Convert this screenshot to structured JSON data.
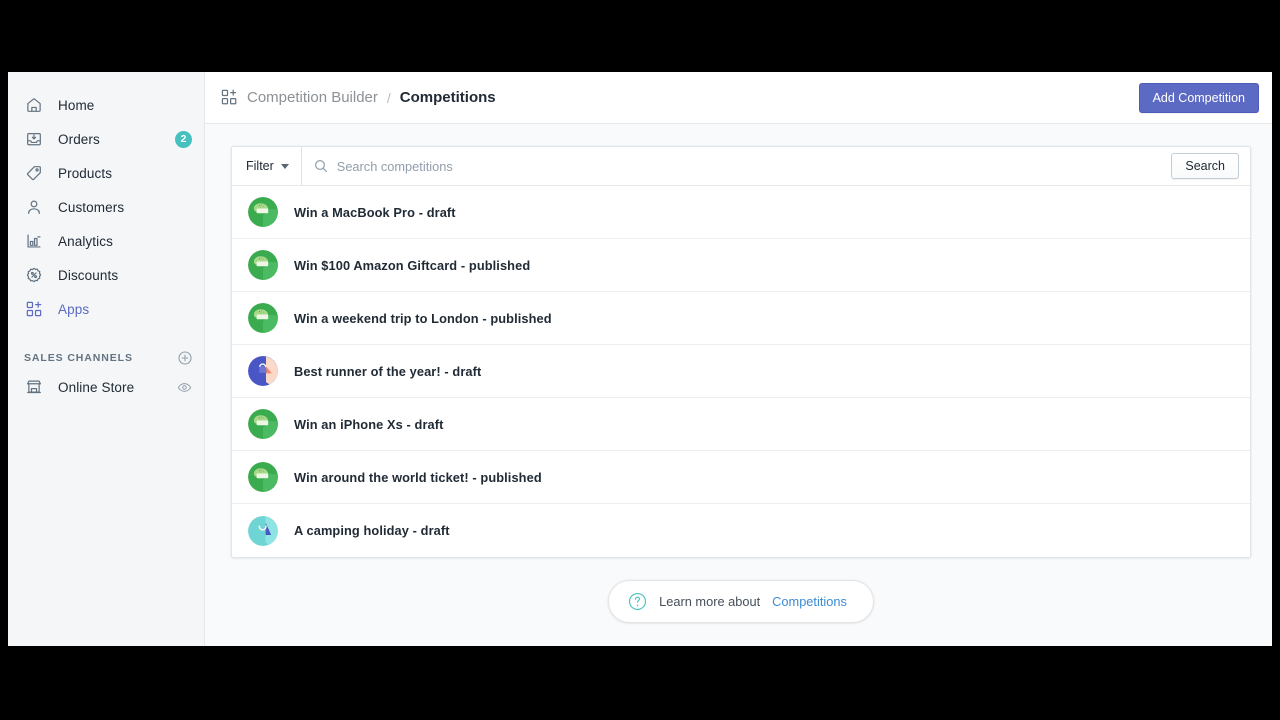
{
  "colors": {
    "accent_indigo": "#5c6ac4",
    "badge_teal": "#47c1bf",
    "link_blue": "#3b8bd6",
    "sidebar_bg": "#f4f6f8",
    "page_bg": "#f9fafb"
  },
  "sidebar": {
    "items": [
      {
        "label": "Home",
        "icon": "home-icon",
        "badge": "",
        "active": false
      },
      {
        "label": "Orders",
        "icon": "orders-icon",
        "badge": "2",
        "active": false
      },
      {
        "label": "Products",
        "icon": "products-icon",
        "badge": "",
        "active": false
      },
      {
        "label": "Customers",
        "icon": "customers-icon",
        "badge": "",
        "active": false
      },
      {
        "label": "Analytics",
        "icon": "analytics-icon",
        "badge": "",
        "active": false
      },
      {
        "label": "Discounts",
        "icon": "discounts-icon",
        "badge": "",
        "active": false
      },
      {
        "label": "Apps",
        "icon": "apps-icon",
        "badge": "",
        "active": true
      }
    ],
    "sales_channels": {
      "header": "SALES CHANNELS",
      "add_icon": "plus-circle-icon",
      "channels": [
        {
          "label": "Online Store",
          "icon": "store-icon",
          "action_icon": "eye-icon"
        }
      ]
    }
  },
  "topbar": {
    "breadcrumb_icon": "apps-icon",
    "parent": "Competition Builder",
    "separator": "/",
    "current": "Competitions",
    "add_button": "Add Competition"
  },
  "filterbar": {
    "filter_label": "Filter",
    "search_placeholder": "Search competitions",
    "search_value": "",
    "search_button": "Search",
    "search_icon": "search-icon"
  },
  "competitions": [
    {
      "title": "Win a MacBook Pro - draft",
      "avatar": "green"
    },
    {
      "title": "Win $100 Amazon Giftcard - published",
      "avatar": "green"
    },
    {
      "title": "Win a weekend trip to London - published",
      "avatar": "green"
    },
    {
      "title": "Best runner of the year! - draft",
      "avatar": "indigo"
    },
    {
      "title": "Win an iPhone Xs - draft",
      "avatar": "green"
    },
    {
      "title": "Win around the world ticket! - published",
      "avatar": "green"
    },
    {
      "title": "A camping holiday - draft",
      "avatar": "teal"
    }
  ],
  "footer": {
    "help_icon": "question-circle-icon",
    "text": "Learn more about",
    "link": "Competitions"
  }
}
